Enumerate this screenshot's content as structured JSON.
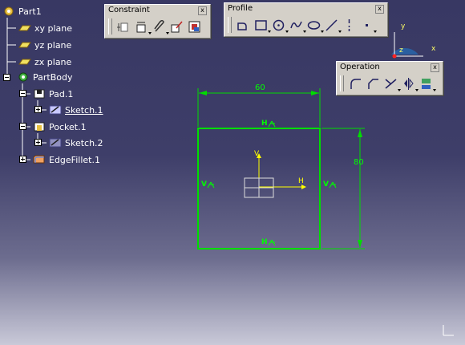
{
  "tree": {
    "root": "Part1",
    "planes": [
      "xy plane",
      "yz plane",
      "zx plane"
    ],
    "body": "PartBody",
    "pad": "Pad.1",
    "sketch1": "Sketch.1",
    "pocket": "Pocket.1",
    "sketch2": "Sketch.2",
    "fillet": "EdgeFillet.1"
  },
  "toolbars": {
    "constraint": {
      "title": "Constraint",
      "close": "x"
    },
    "profile": {
      "title": "Profile",
      "close": "x"
    },
    "operation": {
      "title": "Operation",
      "close": "x"
    }
  },
  "sketch": {
    "width_dim": "60",
    "height_dim": "80",
    "h_top": "H",
    "h_bottom": "H",
    "v_left": "V",
    "v_right": "V",
    "axis_h": "H",
    "axis_v": "V"
  },
  "compass": {
    "x": "x",
    "y": "y",
    "z": "z"
  },
  "colors": {
    "sketch": "#00ff00",
    "axis": "#ffff00",
    "background": "#383863"
  }
}
